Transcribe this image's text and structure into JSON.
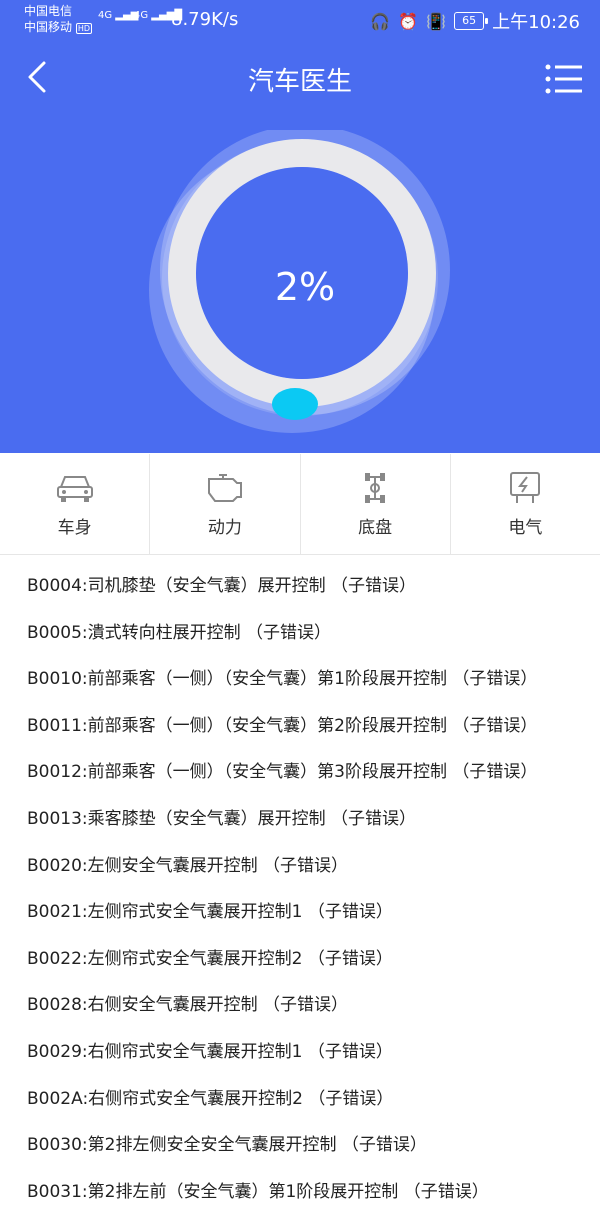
{
  "status_bar": {
    "carrier1": "中国电信",
    "carrier2": "中国移动",
    "hd": "HD",
    "net1": "4G",
    "net2": "4G",
    "speed": "8.79K/s",
    "battery": "65",
    "time": "上午10:26"
  },
  "nav": {
    "title": "汽车医生"
  },
  "gauge": {
    "value": "2%",
    "progress": 0.02
  },
  "categories": [
    {
      "label": "车身",
      "icon": "car-icon"
    },
    {
      "label": "动力",
      "icon": "engine-icon"
    },
    {
      "label": "底盘",
      "icon": "chassis-icon"
    },
    {
      "label": "电气",
      "icon": "electric-icon"
    }
  ],
  "codes": [
    "B0004:司机膝垫（安全气囊）展开控制 （子错误）",
    "B0005:潰式转向柱展开控制 （子错误）",
    "B0010:前部乘客（一侧）（安全气囊）第1阶段展开控制 （子错误）",
    "B0011:前部乘客（一侧）（安全气囊）第2阶段展开控制 （子错误）",
    "B0012:前部乘客（一侧）（安全气囊）第3阶段展开控制 （子错误）",
    "B0013:乘客膝垫（安全气囊）展开控制 （子错误）",
    "B0020:左侧安全气囊展开控制 （子错误）",
    "B0021:左侧帘式安全气囊展开控制1 （子错误）",
    "B0022:左侧帘式安全气囊展开控制2 （子错误）",
    "B0028:右侧安全气囊展开控制 （子错误）",
    "B0029:右侧帘式安全气囊展开控制1 （子错误）",
    "B002A:右侧帘式安全气囊展开控制2 （子错误）",
    "B0030:第2排左侧安全安全气囊展开控制 （子错误）",
    "B0031:第2排左前（安全气囊）第1阶段展开控制 （子错误）"
  ],
  "colors": {
    "header_bg": "#4a6cf0",
    "ring": "#e9e9ec",
    "indicator": "#0bc9f3"
  }
}
